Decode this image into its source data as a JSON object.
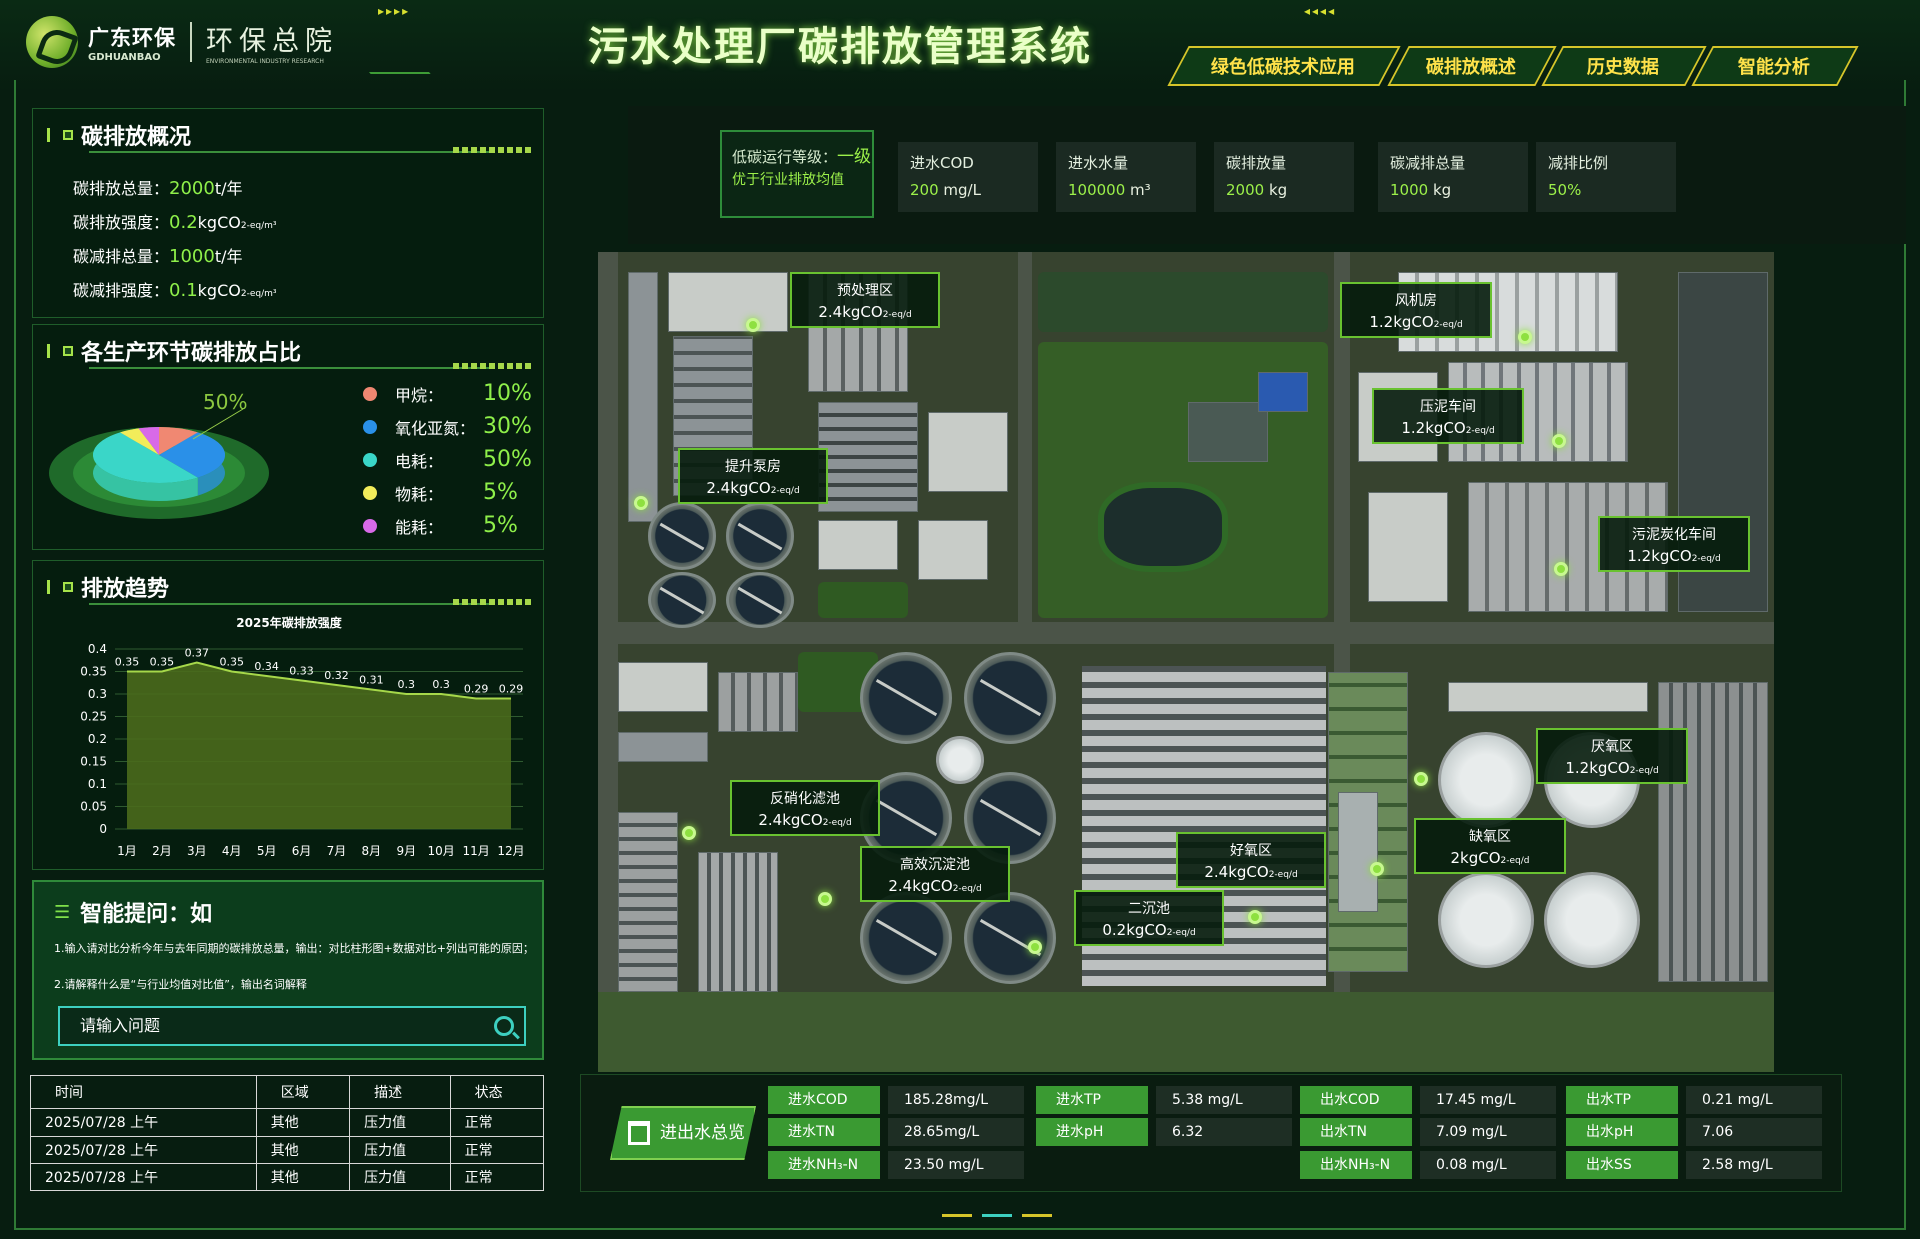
{
  "header": {
    "logo_cn": "广东环保",
    "logo_en": "GDHUANBAO",
    "org_cn": "环保总院",
    "org_en": "ENVIRONMENTAL INDUSTRY RESEARCH",
    "title": "污水处理厂碳排放管理系统",
    "arrows_left": "▸▸▸▸",
    "arrows_right": "◂◂◂◂"
  },
  "nav": [
    {
      "label": "绿色低碳技术应用"
    },
    {
      "label": "碳排放概述"
    },
    {
      "label": "历史数据"
    },
    {
      "label": "智能分析"
    }
  ],
  "overview": {
    "title": "碳排放概况",
    "rows": [
      {
        "label": "碳排放总量：",
        "value": "2000",
        "unit": "t/年",
        "sub": ""
      },
      {
        "label": "碳排放强度：",
        "value": "0.2",
        "unit": "kgCO",
        "sub": "2-eq/m³"
      },
      {
        "label": "碳减排总量：",
        "value": "1000",
        "unit": "t/年",
        "sub": ""
      },
      {
        "label": "碳减排强度：",
        "value": "0.1",
        "unit": "kgCO",
        "sub": "2-eq/m³"
      }
    ]
  },
  "share": {
    "title": "各生产环节碳排放占比",
    "pie_label": "50%",
    "items": [
      {
        "name": "甲烷：",
        "pct": "10%",
        "value": 10,
        "color": "#f08872"
      },
      {
        "name": "氧化亚氮：",
        "pct": "30%",
        "value": 30,
        "color": "#2a90e8"
      },
      {
        "name": "电耗：",
        "pct": "50%",
        "value": 50,
        "color": "#3ad6c8"
      },
      {
        "name": "物耗：",
        "pct": "5%",
        "value": 5,
        "color": "#f2ec5a"
      },
      {
        "name": "能耗：",
        "pct": "5%",
        "value": 5,
        "color": "#d86ae8"
      }
    ]
  },
  "trend": {
    "title": "排放趋势"
  },
  "chart_data": {
    "type": "area",
    "title": "2025年碳排放强度",
    "categories": [
      "1月",
      "2月",
      "3月",
      "4月",
      "5月",
      "6月",
      "7月",
      "8月",
      "9月",
      "10月",
      "11月",
      "12月"
    ],
    "values": [
      0.35,
      0.35,
      0.37,
      0.35,
      0.34,
      0.33,
      0.32,
      0.31,
      0.3,
      0.3,
      0.29,
      0.29
    ],
    "ylim": [
      0,
      0.4
    ],
    "yticks": [
      "0",
      "0.05",
      "0.1",
      "0.15",
      "0.2",
      "0.25",
      "0.3",
      "0.35",
      "0.4"
    ],
    "grid": true,
    "color": "#8cb83a"
  },
  "ask": {
    "title": "智能提问：如",
    "line1": "1.输入请对比分析今年与去年同期的碳排放总量，输出：对比柱形图+数据对比+列出可能的原因；",
    "line2": "2.请解释什么是“与行业均值对比值”，输出名词解释",
    "placeholder": "请输入问题"
  },
  "table": {
    "headers": [
      "时间",
      "区域",
      "描述",
      "状态"
    ],
    "rows": [
      [
        "2025/07/28 上午",
        "其他",
        "压力值",
        "正常"
      ],
      [
        "2025/07/28 上午",
        "其他",
        "压力值",
        "正常"
      ],
      [
        "2025/07/28 上午",
        "其他",
        "压力值",
        "正常"
      ]
    ]
  },
  "kpi": {
    "level_label": "低碳运行等级：",
    "level_value": "一级",
    "level_sub": "优于行业排放均值",
    "items": [
      {
        "label": "进水COD",
        "value": "200",
        "unit": " mg/L"
      },
      {
        "label": "进水水量",
        "value": "100000",
        "unit": " m³"
      },
      {
        "label": "碳排放量",
        "value": "2000",
        "unit": " kg"
      },
      {
        "label": "碳减排总量",
        "value": "1000",
        "unit": " kg"
      },
      {
        "label": "减排比例",
        "value": "50%",
        "unit": ""
      }
    ]
  },
  "map_labels": [
    {
      "name": "预处理区",
      "value": "2.4",
      "unit": "kgCO",
      "sub": "2-eq/d"
    },
    {
      "name": "风机房",
      "value": "1.2",
      "unit": "kgCO",
      "sub": "2-eq/d"
    },
    {
      "name": "提升泵房",
      "value": "2.4",
      "unit": "kgCO",
      "sub": "2-eq/d"
    },
    {
      "name": "压泥车间",
      "value": "1.2",
      "unit": "kgCO",
      "sub": "2-eq/d"
    },
    {
      "name": "污泥炭化车间",
      "value": "1.2",
      "unit": "kgCO",
      "sub": "2-eq/d"
    },
    {
      "name": "厌氧区",
      "value": "1.2",
      "unit": "kgCO",
      "sub": "2-eq/d"
    },
    {
      "name": "反硝化滤池",
      "value": "2.4",
      "unit": "kgCO",
      "sub": "2-eq/d"
    },
    {
      "name": "缺氧区",
      "value": "2",
      "unit": "kgCO",
      "sub": "2-eq/d"
    },
    {
      "name": "好氧区",
      "value": "2.4",
      "unit": "kgCO",
      "sub": "2-eq/d"
    },
    {
      "name": "高效沉淀池",
      "value": "2.4",
      "unit": "kgCO",
      "sub": "2-eq/d"
    },
    {
      "name": "二沉池",
      "value": "0.2",
      "unit": "kgCO",
      "sub": "2-eq/d"
    }
  ],
  "water": {
    "button": "进出水总览",
    "items": [
      {
        "label": "进水COD",
        "value": "185.28mg/L"
      },
      {
        "label": "进水TN",
        "value": "28.65mg/L"
      },
      {
        "label": "进水NH₃-N",
        "value": "23.50 mg/L"
      },
      {
        "label": "进水TP",
        "value": "5.38 mg/L"
      },
      {
        "label": "进水pH",
        "value": "6.32"
      },
      {
        "label": "出水COD",
        "value": "17.45 mg/L"
      },
      {
        "label": "出水TN",
        "value": "7.09 mg/L"
      },
      {
        "label": "出水NH₃-N",
        "value": "0.08 mg/L"
      },
      {
        "label": "出水TP",
        "value": "0.21 mg/L"
      },
      {
        "label": "出水pH",
        "value": "7.06"
      },
      {
        "label": "出水SS",
        "value": "2.58 mg/L"
      }
    ]
  }
}
